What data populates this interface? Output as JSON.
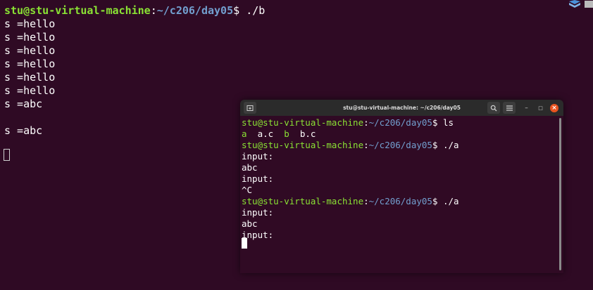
{
  "background_terminal": {
    "prompt_user": "stu@stu-virtual-machine",
    "prompt_sep": ":",
    "prompt_path": "~/c206/day05",
    "prompt_end": "$ ",
    "command": "./b",
    "output": [
      "s =hello",
      "s =hello",
      "s =hello",
      "s =hello",
      "s =hello",
      "s =hello",
      "s =abc",
      "",
      "s =abc"
    ]
  },
  "terminal_window": {
    "title": "stu@stu-virtual-machine: ~/c206/day05",
    "prompt_user": "stu@stu-virtual-machine",
    "prompt_sep": ":",
    "prompt_path": "~/c206/day05",
    "prompt_end": "$ ",
    "ls_command": "ls",
    "ls_items": [
      "a",
      "a.c",
      "b",
      "b.c"
    ],
    "run1_command": "./a",
    "run1_output": [
      "input:",
      "abc",
      "input:",
      "^C"
    ],
    "run2_command": "./a",
    "run2_output": [
      "input:",
      "abc",
      "input:"
    ],
    "buttons": {
      "new_tab_icon": "new-tab-icon",
      "search_icon": "search-icon",
      "menu_icon": "hamburger-menu-icon",
      "minimize": "–",
      "maximize": "□",
      "close": "×"
    }
  },
  "colors": {
    "terminal_bg": "#300a24",
    "prompt_user": "#8ae234",
    "prompt_path": "#729fcf",
    "close_button": "#e95420"
  }
}
